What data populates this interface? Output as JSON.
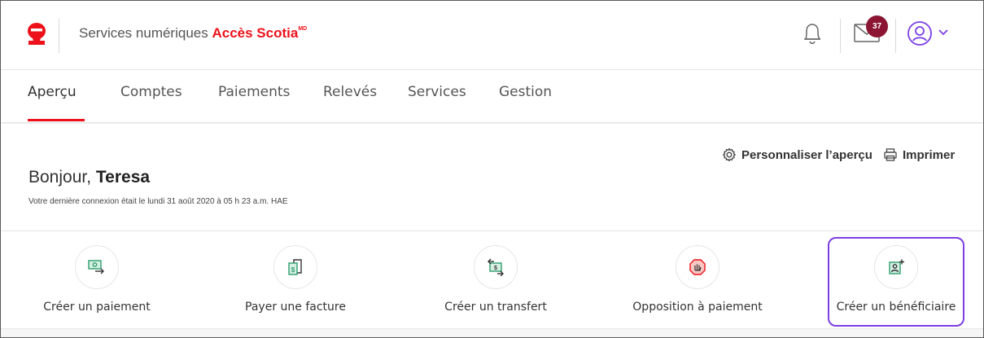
{
  "header": {
    "brand_prefix": "Services numériques ",
    "brand_strong": "Accès Scotia",
    "brand_mark": "MD",
    "mail_count": "37"
  },
  "nav": {
    "items": [
      {
        "label": "Aperçu"
      },
      {
        "label": "Comptes"
      },
      {
        "label": "Paiements"
      },
      {
        "label": "Relevés"
      },
      {
        "label": "Services"
      },
      {
        "label": "Gestion"
      }
    ]
  },
  "greeting": {
    "hello": "Bonjour, ",
    "name": "Teresa",
    "last_login": "Votre dernière connexion était le lundi 31 août 2020 à 05 h 23 a.m. HAE"
  },
  "tools": {
    "personalize": "Personnaliser l’aperçu",
    "print": "Imprimer"
  },
  "quick_actions": [
    {
      "label": "Créer un paiement",
      "icon": "payment-icon"
    },
    {
      "label": "Payer une facture",
      "icon": "bill-icon"
    },
    {
      "label": "Créer un transfert",
      "icon": "transfer-icon"
    },
    {
      "label": "Opposition à paiement",
      "icon": "stop-payment-icon"
    },
    {
      "label": "Créer un bénéficiaire",
      "icon": "add-payee-icon"
    }
  ],
  "colors": {
    "brand_red": "#ec111a",
    "badge": "#8b1533",
    "highlight": "#7b3fe4",
    "icon_green": "#2f9e6e"
  }
}
